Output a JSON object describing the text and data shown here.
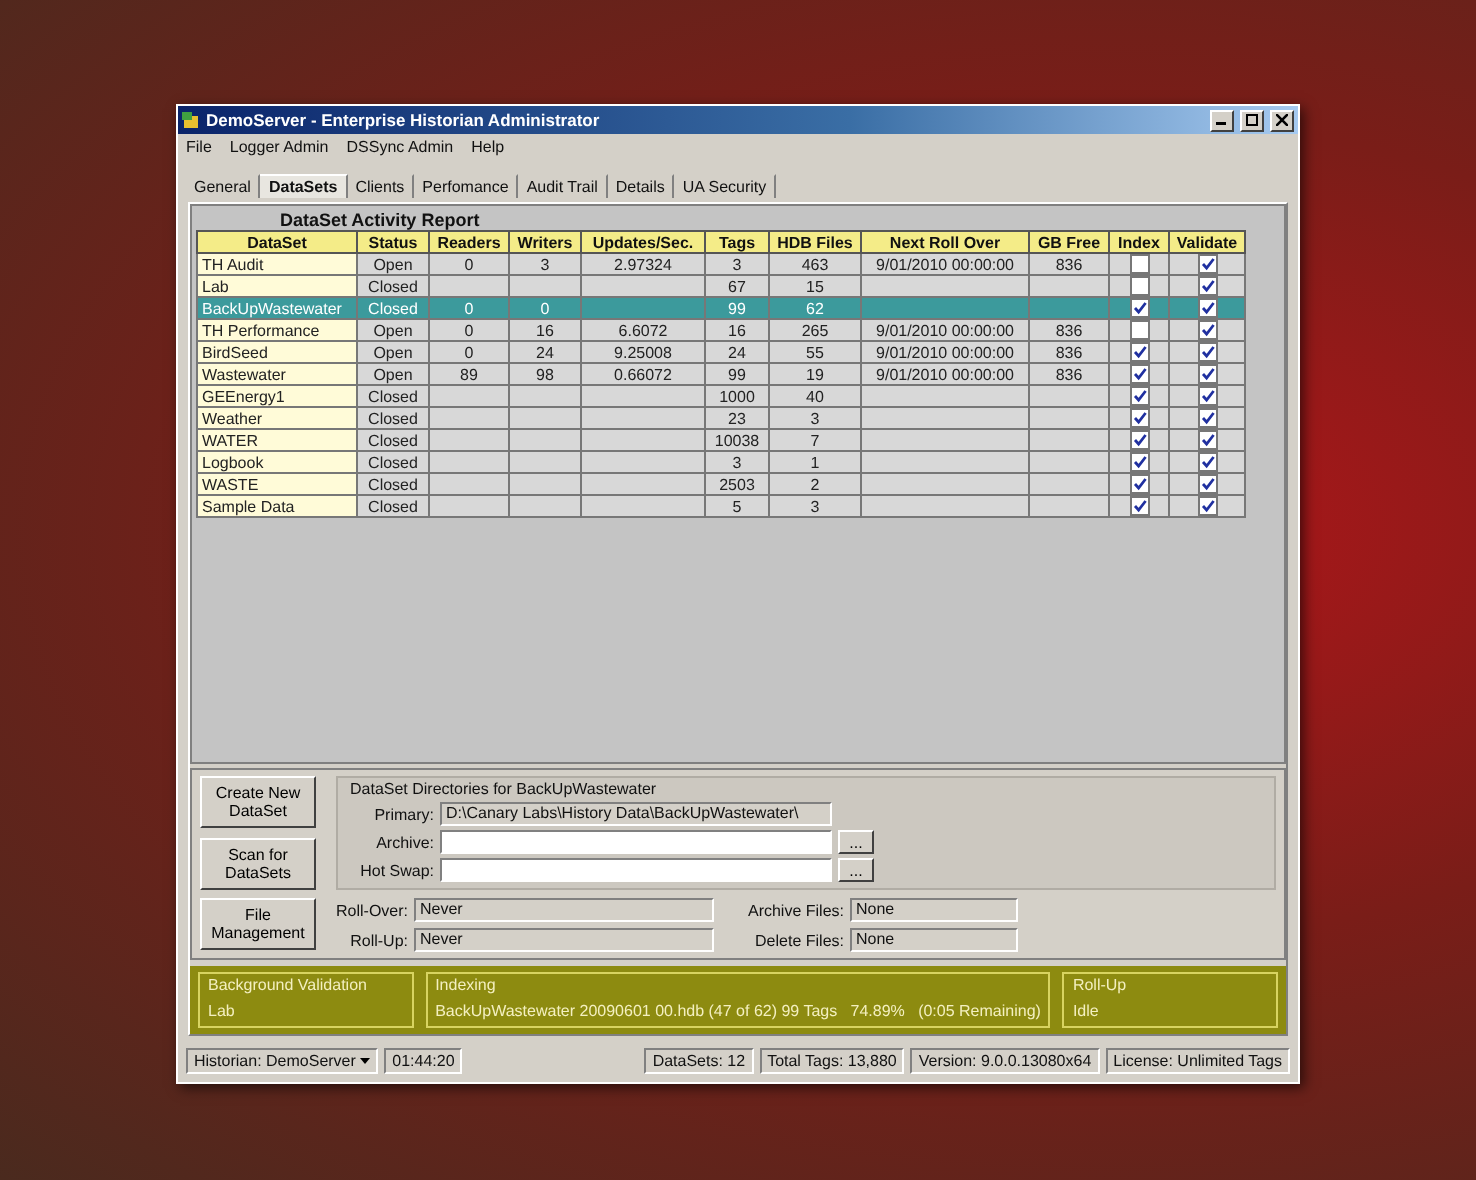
{
  "window": {
    "title": "DemoServer - Enterprise Historian Administrator"
  },
  "menu": [
    "File",
    "Logger Admin",
    "DSSync Admin",
    "Help"
  ],
  "tabs": [
    {
      "label": "General",
      "selected": false
    },
    {
      "label": "DataSets",
      "selected": true
    },
    {
      "label": "Clients",
      "selected": false
    },
    {
      "label": "Perfomance",
      "selected": false
    },
    {
      "label": "Audit Trail",
      "selected": false
    },
    {
      "label": "Details",
      "selected": false
    },
    {
      "label": "UA Security",
      "selected": false
    }
  ],
  "report": {
    "title": "DataSet Activity Report",
    "columns": [
      "DataSet",
      "Status",
      "Readers",
      "Writers",
      "Updates/Sec.",
      "Tags",
      "HDB Files",
      "Next Roll Over",
      "GB Free",
      "Index",
      "Validate"
    ],
    "rows": [
      {
        "cells": [
          "TH Audit",
          "Open",
          "0",
          "3",
          "2.97324",
          "3",
          "463",
          "9/01/2010 00:00:00",
          "836"
        ],
        "index": false,
        "validate": true,
        "selected": false
      },
      {
        "cells": [
          "Lab",
          "Closed",
          "",
          "",
          "",
          "67",
          "15",
          "",
          ""
        ],
        "index": false,
        "validate": true,
        "selected": false
      },
      {
        "cells": [
          "BackUpWastewater",
          "Closed",
          "0",
          "0",
          "",
          "99",
          "62",
          "",
          ""
        ],
        "index": true,
        "validate": true,
        "selected": true
      },
      {
        "cells": [
          "TH Performance",
          "Open",
          "0",
          "16",
          "6.6072",
          "16",
          "265",
          "9/01/2010 00:00:00",
          "836"
        ],
        "index": false,
        "validate": true,
        "selected": false
      },
      {
        "cells": [
          "BirdSeed",
          "Open",
          "0",
          "24",
          "9.25008",
          "24",
          "55",
          "9/01/2010 00:00:00",
          "836"
        ],
        "index": true,
        "validate": true,
        "selected": false
      },
      {
        "cells": [
          "Wastewater",
          "Open",
          "89",
          "98",
          "0.66072",
          "99",
          "19",
          "9/01/2010 00:00:00",
          "836"
        ],
        "index": true,
        "validate": true,
        "selected": false
      },
      {
        "cells": [
          "GEEnergy1",
          "Closed",
          "",
          "",
          "",
          "1000",
          "40",
          "",
          ""
        ],
        "index": true,
        "validate": true,
        "selected": false
      },
      {
        "cells": [
          "Weather",
          "Closed",
          "",
          "",
          "",
          "23",
          "3",
          "",
          ""
        ],
        "index": true,
        "validate": true,
        "selected": false
      },
      {
        "cells": [
          "WATER",
          "Closed",
          "",
          "",
          "",
          "10038",
          "7",
          "",
          ""
        ],
        "index": true,
        "validate": true,
        "selected": false
      },
      {
        "cells": [
          "Logbook",
          "Closed",
          "",
          "",
          "",
          "3",
          "1",
          "",
          ""
        ],
        "index": true,
        "validate": true,
        "selected": false
      },
      {
        "cells": [
          "WASTE",
          "Closed",
          "",
          "",
          "",
          "2503",
          "2",
          "",
          ""
        ],
        "index": true,
        "validate": true,
        "selected": false
      },
      {
        "cells": [
          "Sample Data",
          "Closed",
          "",
          "",
          "",
          "5",
          "3",
          "",
          ""
        ],
        "index": true,
        "validate": true,
        "selected": false
      }
    ]
  },
  "buttons": [
    "Create New DataSet",
    "Scan for DataSets",
    "File Management"
  ],
  "directories": {
    "title": "DataSet Directories for BackUpWastewater",
    "fields": [
      {
        "label": "Primary:",
        "value": "D:\\Canary Labs\\History Data\\BackUpWastewater\\",
        "kind": "readonly"
      },
      {
        "label": "Archive:",
        "kind": "browse",
        "button": "..."
      },
      {
        "label": "Hot Swap:",
        "kind": "browse",
        "button": "..."
      }
    ]
  },
  "schedule": [
    {
      "label": "Roll-Over:",
      "value": "Never"
    },
    {
      "label": "Archive Files:",
      "value": "None"
    },
    {
      "label": "Roll-Up:",
      "value": "Never"
    },
    {
      "label": "Delete Files:",
      "value": "None"
    }
  ],
  "activity": [
    {
      "title": "Background Validation",
      "value": "Lab"
    },
    {
      "title": "Indexing",
      "value": "BackUpWastewater 20090601 00.hdb (47 of 62) 99 Tags   74.89%   (0:05 Remaining)"
    },
    {
      "title": "Roll-Up",
      "value": "Idle"
    }
  ],
  "status_bar": {
    "historian": "Historian: DemoServer",
    "time": "01:44:20",
    "items": [
      "DataSets: 12",
      "Total Tags: 13,880",
      "Version: 9.0.0.13080x64",
      "License: Unlimited Tags"
    ]
  }
}
